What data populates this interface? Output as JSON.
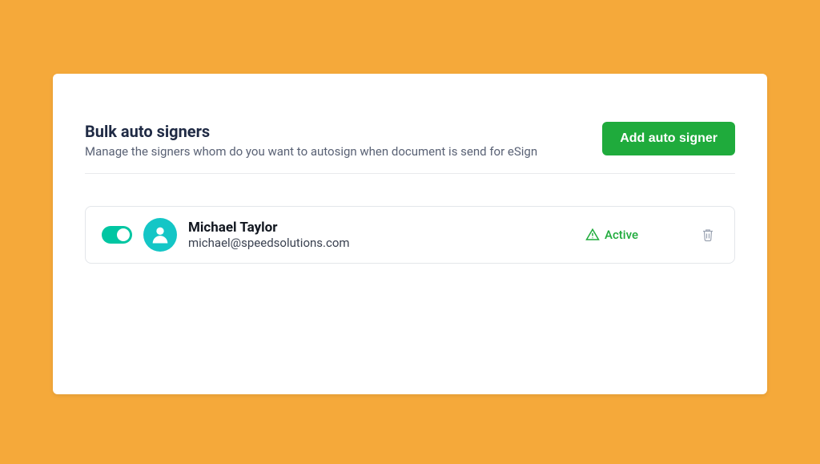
{
  "header": {
    "title": "Bulk auto signers",
    "subtitle": "Manage the signers whom do you want to autosign when document is send for eSign",
    "add_button_label": "Add auto signer"
  },
  "colors": {
    "page_bg": "#f5a93a",
    "accent_green": "#1fab3c",
    "toggle_teal": "#00c6a2",
    "avatar_teal": "#14c6c6"
  },
  "signers": [
    {
      "enabled": true,
      "name": "Michael Taylor",
      "email": "michael@speedsolutions.com",
      "status": "Active"
    }
  ]
}
